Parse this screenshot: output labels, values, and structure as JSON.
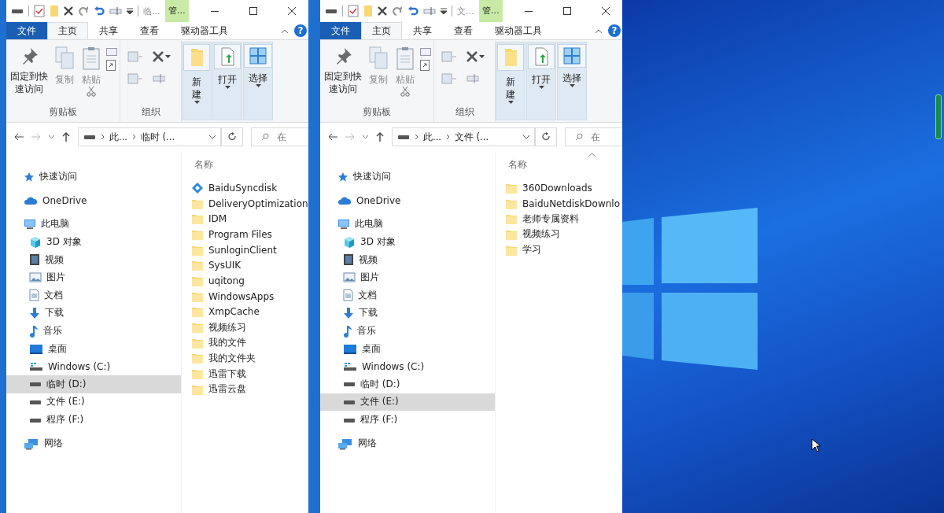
{
  "windows": [
    {
      "title": "临…",
      "context_tab": "管…",
      "file_tab": "文件",
      "tabs": [
        {
          "label": "主页",
          "selected": true
        },
        {
          "label": "共享",
          "selected": false
        },
        {
          "label": "查看",
          "selected": false
        },
        {
          "label": "驱动器工具",
          "selected": false
        }
      ],
      "help": "?",
      "clipboard": {
        "label": "剪贴板",
        "buttons": [
          {
            "label": "固定到快速访问",
            "kind": "pin",
            "disabled": false
          },
          {
            "label": "复制",
            "kind": "copy",
            "disabled": true
          },
          {
            "label": "粘贴",
            "kind": "paste",
            "disabled": true
          }
        ]
      },
      "organize": {
        "label": "组织"
      },
      "large_buttons": [
        {
          "label": "新建",
          "kind": "new"
        },
        {
          "label": "打开",
          "kind": "open"
        },
        {
          "label": "选择",
          "kind": "select"
        }
      ],
      "address": {
        "segments": [
          "此...",
          "临时 (..."
        ],
        "search_placeholder": "在"
      },
      "nav": [
        {
          "label": "快速访问",
          "kind": "star",
          "selected": false
        },
        {
          "label": "OneDrive",
          "kind": "cloud",
          "selected": false
        },
        {
          "label": "此电脑",
          "kind": "pc",
          "selected": false,
          "children": [
            {
              "label": "3D 对象",
              "kind": "cube",
              "selected": false
            },
            {
              "label": "视频",
              "kind": "video",
              "selected": false
            },
            {
              "label": "图片",
              "kind": "picture",
              "selected": false
            },
            {
              "label": "文档",
              "kind": "document",
              "selected": false
            },
            {
              "label": "下载",
              "kind": "download",
              "selected": false
            },
            {
              "label": "音乐",
              "kind": "music",
              "selected": false
            },
            {
              "label": "桌面",
              "kind": "desktop",
              "selected": false
            },
            {
              "label": "Windows (C:)",
              "kind": "system-drive",
              "selected": false
            },
            {
              "label": "临时 (D:)",
              "kind": "drive",
              "selected": true
            },
            {
              "label": "文件 (E:)",
              "kind": "drive",
              "selected": false
            },
            {
              "label": "程序 (F:)",
              "kind": "drive",
              "selected": false
            }
          ]
        },
        {
          "label": "网络",
          "kind": "network",
          "selected": false
        }
      ],
      "column_header": "名称",
      "sort_indicator": false,
      "files": [
        {
          "name": "BaiduSyncdisk",
          "kind": "sync"
        },
        {
          "name": "DeliveryOptimization",
          "kind": "folder"
        },
        {
          "name": "IDM",
          "kind": "folder"
        },
        {
          "name": "Program Files",
          "kind": "folder"
        },
        {
          "name": "SunloginClient",
          "kind": "folder"
        },
        {
          "name": "SysUIK",
          "kind": "folder"
        },
        {
          "name": "uqitong",
          "kind": "folder"
        },
        {
          "name": "WindowsApps",
          "kind": "folder"
        },
        {
          "name": "XmpCache",
          "kind": "folder"
        },
        {
          "name": "视频练习",
          "kind": "folder"
        },
        {
          "name": "我的文件",
          "kind": "folder"
        },
        {
          "name": "我的文件夹",
          "kind": "folder"
        },
        {
          "name": "迅雷下载",
          "kind": "folder"
        },
        {
          "name": "迅雷云盘",
          "kind": "folder"
        }
      ]
    },
    {
      "title": "文…",
      "context_tab": "管…",
      "file_tab": "文件",
      "tabs": [
        {
          "label": "主页",
          "selected": true
        },
        {
          "label": "共享",
          "selected": false
        },
        {
          "label": "查看",
          "selected": false
        },
        {
          "label": "驱动器工具",
          "selected": false
        }
      ],
      "help": "?",
      "clipboard": {
        "label": "剪贴板",
        "buttons": [
          {
            "label": "固定到快速访问",
            "kind": "pin",
            "disabled": false
          },
          {
            "label": "复制",
            "kind": "copy",
            "disabled": true
          },
          {
            "label": "粘贴",
            "kind": "paste",
            "disabled": true
          }
        ]
      },
      "organize": {
        "label": "组织"
      },
      "large_buttons": [
        {
          "label": "新建",
          "kind": "new"
        },
        {
          "label": "打开",
          "kind": "open"
        },
        {
          "label": "选择",
          "kind": "select"
        }
      ],
      "address": {
        "segments": [
          "此...",
          "文件 (..."
        ],
        "search_placeholder": "在"
      },
      "nav": [
        {
          "label": "快速访问",
          "kind": "star",
          "selected": false
        },
        {
          "label": "OneDrive",
          "kind": "cloud",
          "selected": false
        },
        {
          "label": "此电脑",
          "kind": "pc",
          "selected": false,
          "children": [
            {
              "label": "3D 对象",
              "kind": "cube",
              "selected": false
            },
            {
              "label": "视频",
              "kind": "video",
              "selected": false
            },
            {
              "label": "图片",
              "kind": "picture",
              "selected": false
            },
            {
              "label": "文档",
              "kind": "document",
              "selected": false
            },
            {
              "label": "下载",
              "kind": "download",
              "selected": false
            },
            {
              "label": "音乐",
              "kind": "music",
              "selected": false
            },
            {
              "label": "桌面",
              "kind": "desktop",
              "selected": false
            },
            {
              "label": "Windows (C:)",
              "kind": "system-drive",
              "selected": false
            },
            {
              "label": "临时 (D:)",
              "kind": "drive",
              "selected": false
            },
            {
              "label": "文件 (E:)",
              "kind": "drive",
              "selected": true
            },
            {
              "label": "程序 (F:)",
              "kind": "drive",
              "selected": false
            }
          ]
        },
        {
          "label": "网络",
          "kind": "network",
          "selected": false
        }
      ],
      "column_header": "名称",
      "sort_indicator": true,
      "files": [
        {
          "name": "360Downloads",
          "kind": "folder"
        },
        {
          "name": "BaiduNetdiskDownlo",
          "kind": "folder"
        },
        {
          "name": "老师专属资料",
          "kind": "folder"
        },
        {
          "name": "视频练习",
          "kind": "folder"
        },
        {
          "name": "学习",
          "kind": "folder"
        }
      ]
    }
  ]
}
